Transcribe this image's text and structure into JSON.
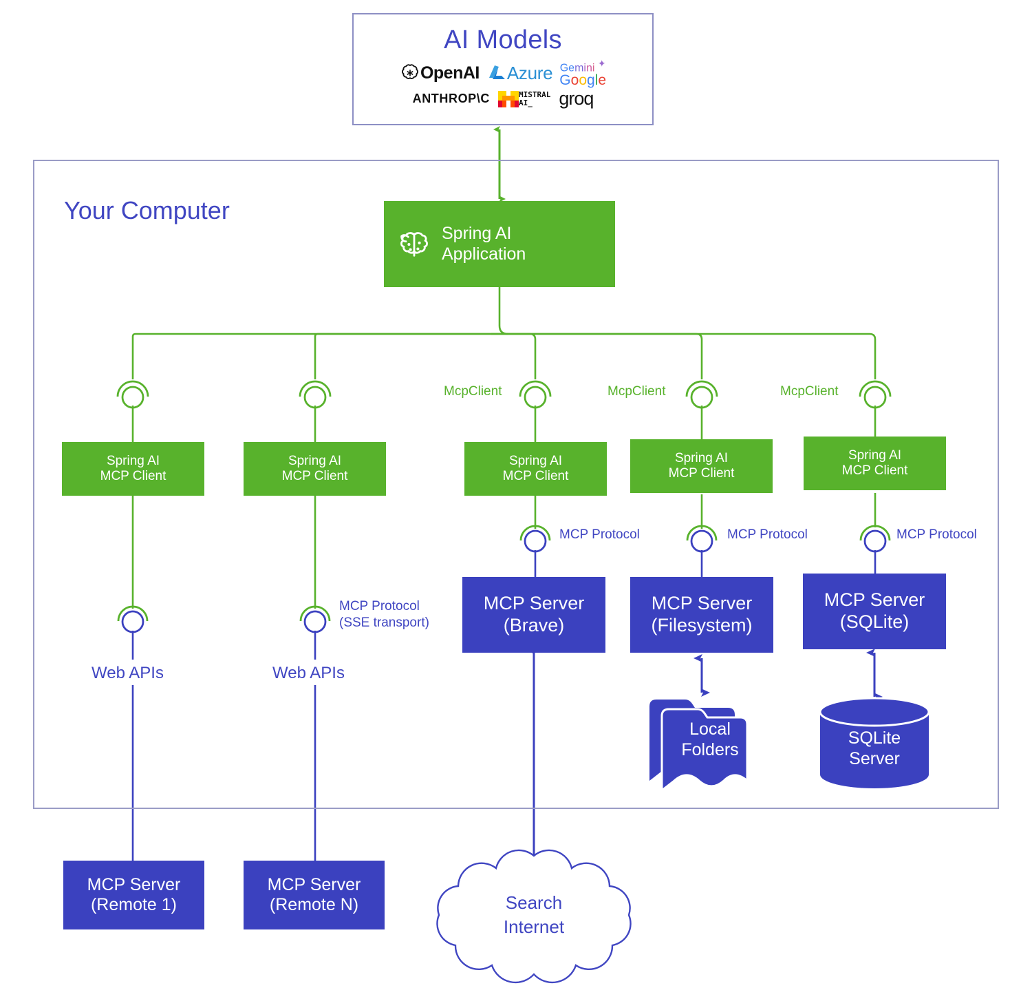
{
  "colors": {
    "green": "#58b22c",
    "blue": "#3b41bf",
    "label_blue": "#4046c2",
    "container_border": "#9a9cc6"
  },
  "ai_models": {
    "title": "AI Models",
    "logos": [
      {
        "name": "openai",
        "label": "OpenAI"
      },
      {
        "name": "azure",
        "label": "Azure"
      },
      {
        "name": "gemini",
        "label": "Gemini",
        "sub": "Google"
      },
      {
        "name": "anthropic",
        "label": "ANTHROP\\C"
      },
      {
        "name": "mistral",
        "label": "MISTRAL",
        "sub": "AI_"
      },
      {
        "name": "groq",
        "label": "groq"
      }
    ]
  },
  "container": {
    "label": "Your Computer"
  },
  "application": {
    "line1": "Spring AI",
    "line2": "Application",
    "icon": "brain-leaf-icon"
  },
  "mcp_clients": [
    {
      "line1": "Spring AI",
      "line2": "MCP Client",
      "connector_label": ""
    },
    {
      "line1": "Spring AI",
      "line2": "MCP Client",
      "connector_label": ""
    },
    {
      "line1": "Spring AI",
      "line2": "MCP Client",
      "connector_label": "McpClient"
    },
    {
      "line1": "Spring AI",
      "line2": "MCP Client",
      "connector_label": "McpClient"
    },
    {
      "line1": "Spring AI",
      "line2": "MCP Client",
      "connector_label": "McpClient"
    }
  ],
  "protocol_labels": {
    "sse_line1": "MCP Protocol",
    "sse_line2": "(SSE transport)",
    "stdio": "MCP Protocol"
  },
  "web_apis": [
    {
      "label": "Web APIs"
    },
    {
      "label": "Web APIs"
    }
  ],
  "local_servers": [
    {
      "line1": "MCP Server",
      "line2": "(Brave)"
    },
    {
      "line1": "MCP Server",
      "line2": "(Filesystem)"
    },
    {
      "line1": "MCP Server",
      "line2": "(SQLite)"
    }
  ],
  "remote_servers": [
    {
      "line1": "MCP Server",
      "line2": "(Remote 1)"
    },
    {
      "line1": "MCP Server",
      "line2": "(Remote N)"
    }
  ],
  "resources": [
    {
      "name": "local-folders",
      "line1": "Local",
      "line2": "Folders"
    },
    {
      "name": "sqlite-server",
      "line1": "SQLite",
      "line2": "Server"
    },
    {
      "name": "search-internet",
      "line1": "Search",
      "line2": "Internet"
    }
  ]
}
